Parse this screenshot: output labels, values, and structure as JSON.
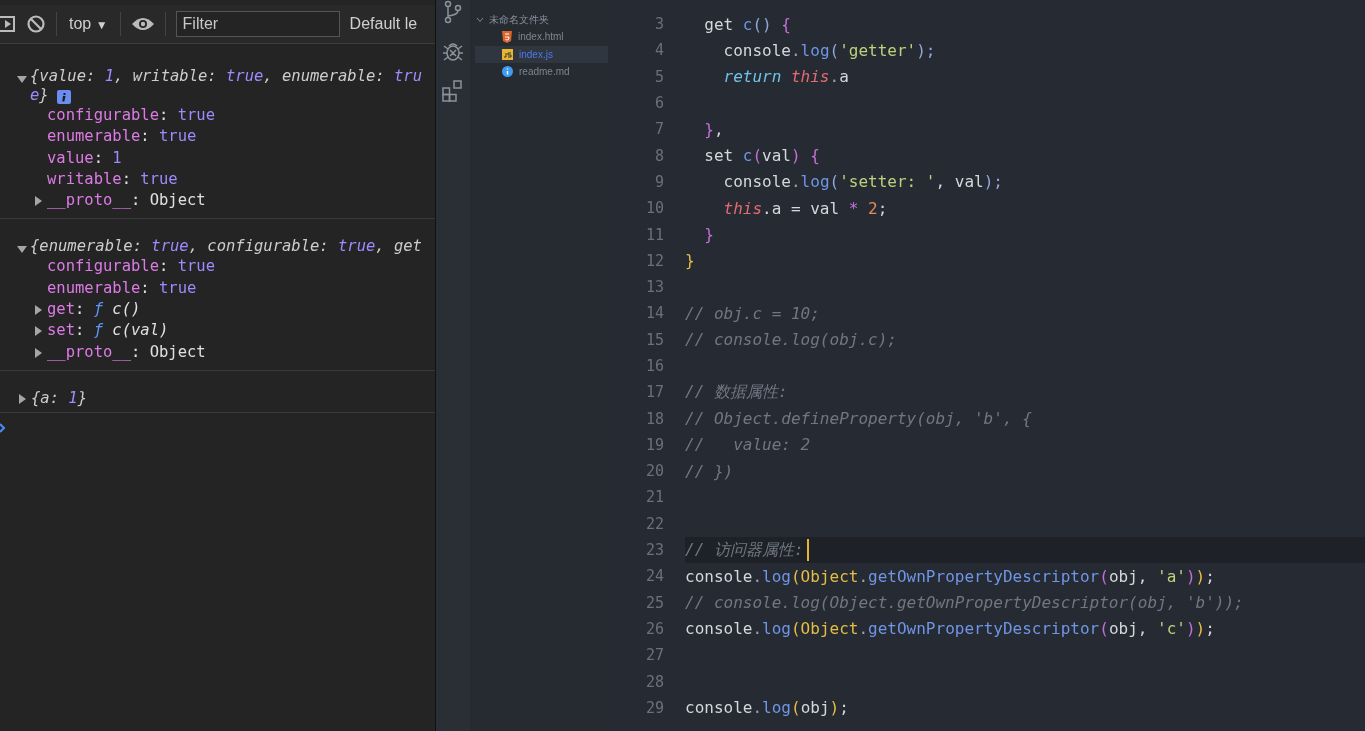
{
  "console": {
    "toolbar": {
      "context": "top",
      "context_arrow": "▼",
      "filter_placeholder": "Filter",
      "levels": "Default le"
    },
    "entries": [
      {
        "expanded": true,
        "info": true,
        "summary": [
          {
            "text": "{value: ",
            "kind": "plain"
          },
          {
            "text": "1",
            "kind": "num"
          },
          {
            "text": ", writable: ",
            "kind": "plain"
          },
          {
            "text": "true",
            "kind": "bool"
          },
          {
            "text": ", enumerable: ",
            "kind": "plain"
          },
          {
            "text": "true",
            "kind": "bool"
          },
          {
            "text": "}",
            "kind": "plain"
          }
        ],
        "properties": [
          {
            "expandable": false,
            "name": "configurable",
            "value": [
              {
                "text": ": ",
                "kind": "obj"
              },
              {
                "text": "true",
                "kind": "bool"
              }
            ]
          },
          {
            "expandable": false,
            "name": "enumerable",
            "value": [
              {
                "text": ": ",
                "kind": "obj"
              },
              {
                "text": "true",
                "kind": "bool"
              }
            ]
          },
          {
            "expandable": false,
            "name": "value",
            "value": [
              {
                "text": ": ",
                "kind": "obj"
              },
              {
                "text": "1",
                "kind": "num"
              }
            ]
          },
          {
            "expandable": false,
            "name": "writable",
            "value": [
              {
                "text": ": ",
                "kind": "obj"
              },
              {
                "text": "true",
                "kind": "bool"
              }
            ]
          },
          {
            "expandable": true,
            "name": "__proto__",
            "value": [
              {
                "text": ": Object",
                "kind": "obj"
              }
            ]
          }
        ]
      },
      {
        "expanded": true,
        "info": false,
        "summary": [
          {
            "text": "{enumerable: ",
            "kind": "plain"
          },
          {
            "text": "true",
            "kind": "bool"
          },
          {
            "text": ", configurable: ",
            "kind": "plain"
          },
          {
            "text": "true",
            "kind": "bool"
          },
          {
            "text": ", get",
            "kind": "plain"
          }
        ],
        "properties": [
          {
            "expandable": false,
            "name": "configurable",
            "value": [
              {
                "text": ": ",
                "kind": "obj"
              },
              {
                "text": "true",
                "kind": "bool"
              }
            ]
          },
          {
            "expandable": false,
            "name": "enumerable",
            "value": [
              {
                "text": ": ",
                "kind": "obj"
              },
              {
                "text": "true",
                "kind": "bool"
              }
            ]
          },
          {
            "expandable": true,
            "name": "get",
            "value": [
              {
                "text": ": ",
                "kind": "obj"
              },
              {
                "text": "ƒ",
                "kind": "fn"
              },
              {
                "text": " c()",
                "kind": "sig"
              }
            ]
          },
          {
            "expandable": true,
            "name": "set",
            "value": [
              {
                "text": ": ",
                "kind": "obj"
              },
              {
                "text": "ƒ",
                "kind": "fn"
              },
              {
                "text": " c(val)",
                "kind": "sig"
              }
            ]
          },
          {
            "expandable": true,
            "name": "__proto__",
            "value": [
              {
                "text": ": Object",
                "kind": "obj"
              }
            ]
          }
        ]
      },
      {
        "expanded": false,
        "info": false,
        "summary": [
          {
            "text": "{a: ",
            "kind": "plain"
          },
          {
            "text": "1",
            "kind": "num"
          },
          {
            "text": "}",
            "kind": "plain"
          }
        ]
      }
    ]
  },
  "explorer": {
    "folder": {
      "name": "未命名文件夹",
      "expanded": true,
      "files": [
        {
          "name": "index.html",
          "kind": "html",
          "selected": false
        },
        {
          "name": "index.js",
          "kind": "js",
          "selected": true
        },
        {
          "name": "readme.md",
          "kind": "info",
          "selected": false
        }
      ]
    }
  },
  "editor": {
    "lines": [
      {
        "number": "3",
        "current": false,
        "tokens": [
          {
            "text": "  get ",
            "kind": "plain"
          },
          {
            "text": "c",
            "kind": "func"
          },
          {
            "text": "()",
            "kind": "paren"
          },
          {
            "text": " {",
            "kind": "brace"
          }
        ]
      },
      {
        "number": "4",
        "current": false,
        "tokens": [
          {
            "text": "    console",
            "kind": "plain"
          },
          {
            "text": ".",
            "kind": "punct"
          },
          {
            "text": "log",
            "kind": "func"
          },
          {
            "text": "(",
            "kind": "paren"
          },
          {
            "text": "'getter'",
            "kind": "string"
          },
          {
            "text": ");",
            "kind": "paren"
          }
        ]
      },
      {
        "number": "5",
        "current": false,
        "tokens": [
          {
            "text": "    return ",
            "kind": "keyword"
          },
          {
            "text": "this",
            "kind": "this"
          },
          {
            "text": ".",
            "kind": "punct"
          },
          {
            "text": "a",
            "kind": "plain"
          }
        ]
      },
      {
        "number": "6",
        "current": false
      },
      {
        "number": "7",
        "current": false,
        "tokens": [
          {
            "text": "  }",
            "kind": "brace"
          },
          {
            "text": ",",
            "kind": "plain"
          }
        ]
      },
      {
        "number": "8",
        "current": false,
        "tokens": [
          {
            "text": "  set ",
            "kind": "plain"
          },
          {
            "text": "c",
            "kind": "func"
          },
          {
            "text": "(",
            "kind": "brace"
          },
          {
            "text": "val",
            "kind": "plain"
          },
          {
            "text": ")",
            "kind": "brace"
          },
          {
            "text": " {",
            "kind": "brace"
          }
        ]
      },
      {
        "number": "9",
        "current": false,
        "tokens": [
          {
            "text": "    console",
            "kind": "plain"
          },
          {
            "text": ".",
            "kind": "punct"
          },
          {
            "text": "log",
            "kind": "func"
          },
          {
            "text": "(",
            "kind": "paren"
          },
          {
            "text": "'setter: '",
            "kind": "string"
          },
          {
            "text": ", val",
            "kind": "plain"
          },
          {
            "text": ");",
            "kind": "paren"
          }
        ]
      },
      {
        "number": "10",
        "current": false,
        "tokens": [
          {
            "text": "    this",
            "kind": "this"
          },
          {
            "text": ".a = val ",
            "kind": "plain"
          },
          {
            "text": "*",
            "kind": "brace"
          },
          {
            "text": " 2",
            "kind": "number"
          },
          {
            "text": ";",
            "kind": "plain"
          }
        ]
      },
      {
        "number": "11",
        "current": false,
        "tokens": [
          {
            "text": "  }",
            "kind": "brace"
          }
        ]
      },
      {
        "number": "12",
        "current": false,
        "tokens": [
          {
            "text": "}",
            "kind": "yellow"
          }
        ]
      },
      {
        "number": "13",
        "current": false
      },
      {
        "number": "14",
        "current": false,
        "tokens": [
          {
            "text": "// obj.c = 10;",
            "kind": "comment"
          }
        ]
      },
      {
        "number": "15",
        "current": false,
        "tokens": [
          {
            "text": "// console.log(obj.c);",
            "kind": "comment"
          }
        ]
      },
      {
        "number": "16",
        "current": false
      },
      {
        "number": "17",
        "current": false,
        "tokens": [
          {
            "text": "// 数据属性:",
            "kind": "comment"
          }
        ]
      },
      {
        "number": "18",
        "current": false,
        "tokens": [
          {
            "text": "// Object.defineProperty(obj, 'b', {",
            "kind": "comment"
          }
        ]
      },
      {
        "number": "19",
        "current": false,
        "tokens": [
          {
            "text": "//   value: 2",
            "kind": "comment"
          }
        ]
      },
      {
        "number": "20",
        "current": false,
        "tokens": [
          {
            "text": "// })",
            "kind": "comment"
          }
        ]
      },
      {
        "number": "21",
        "current": false
      },
      {
        "number": "22",
        "current": false
      },
      {
        "number": "23",
        "current": true,
        "tokens": [
          {
            "text": "// 访问器属性:",
            "kind": "comment"
          }
        ]
      },
      {
        "number": "24",
        "current": false,
        "tokens": [
          {
            "text": "console",
            "kind": "plain"
          },
          {
            "text": ".",
            "kind": "punct"
          },
          {
            "text": "log",
            "kind": "func"
          },
          {
            "text": "(Object",
            "kind": "yellow"
          },
          {
            "text": ".",
            "kind": "punct"
          },
          {
            "text": "getOwnPropertyDescriptor",
            "kind": "func"
          },
          {
            "text": "(",
            "kind": "brace"
          },
          {
            "text": "obj, ",
            "kind": "plain"
          },
          {
            "text": "'a'",
            "kind": "string"
          },
          {
            "text": ")",
            "kind": "brace"
          },
          {
            "text": ")",
            "kind": "yellow"
          },
          {
            "text": ";",
            "kind": "plain"
          }
        ]
      },
      {
        "number": "25",
        "current": false,
        "tokens": [
          {
            "text": "// console.log(Object.getOwnPropertyDescriptor(obj, 'b'));",
            "kind": "comment"
          }
        ]
      },
      {
        "number": "26",
        "current": false,
        "tokens": [
          {
            "text": "console",
            "kind": "plain"
          },
          {
            "text": ".",
            "kind": "punct"
          },
          {
            "text": "log",
            "kind": "func"
          },
          {
            "text": "(Object",
            "kind": "yellow"
          },
          {
            "text": ".",
            "kind": "punct"
          },
          {
            "text": "getOwnPropertyDescriptor",
            "kind": "func"
          },
          {
            "text": "(",
            "kind": "brace"
          },
          {
            "text": "obj, ",
            "kind": "plain"
          },
          {
            "text": "'c'",
            "kind": "string"
          },
          {
            "text": ")",
            "kind": "brace"
          },
          {
            "text": ")",
            "kind": "yellow"
          },
          {
            "text": ";",
            "kind": "plain"
          }
        ]
      },
      {
        "number": "27",
        "current": false
      },
      {
        "number": "28",
        "current": false
      },
      {
        "number": "29",
        "current": false,
        "tokens": [
          {
            "text": "console",
            "kind": "plain"
          },
          {
            "text": ".",
            "kind": "punct"
          },
          {
            "text": "log",
            "kind": "func"
          },
          {
            "text": "(",
            "kind": "yellow"
          },
          {
            "text": "obj",
            "kind": "plain"
          },
          {
            "text": ")",
            "kind": "yellow"
          },
          {
            "text": ";",
            "kind": "plain"
          }
        ]
      }
    ]
  }
}
